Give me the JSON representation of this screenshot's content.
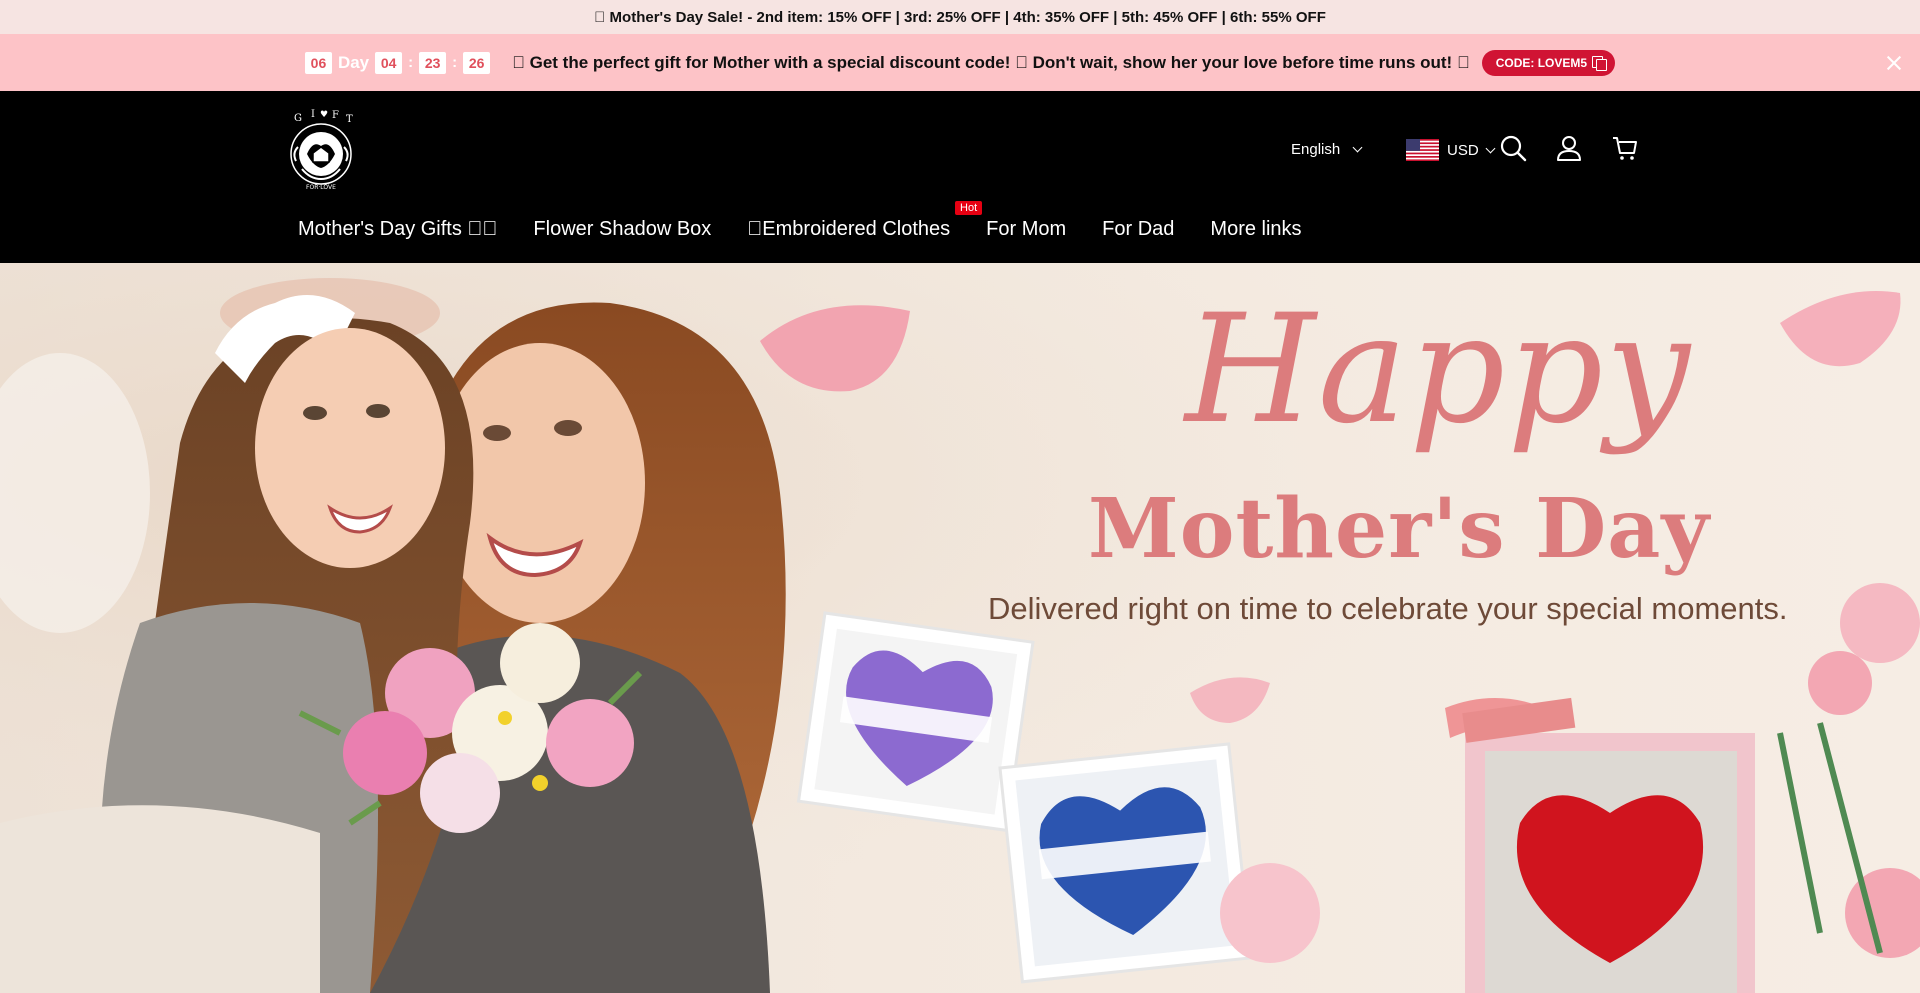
{
  "announcement": {
    "text": "\u0000 Mother's Day Sale! - 2nd item: 15% OFF | 3rd: 25% OFF | 4th: 35% OFF | 5th: 45% OFF | 6th: 55% OFF"
  },
  "promo": {
    "countdown": {
      "days": "06",
      "day_label": "Day",
      "hours": "04",
      "minutes": "23",
      "seconds": "26",
      "sep": ":"
    },
    "message": "\u0000 Get the perfect gift for Mother with a special discount code! \u0000 Don't wait, show her your love before time runs out! \u0000",
    "code_label": "CODE: LOVEM5"
  },
  "header": {
    "language": "English",
    "currency": "USD",
    "nav": [
      {
        "label": "Mother's Day Gifts \u0000\u0000"
      },
      {
        "label": "Flower Shadow Box"
      },
      {
        "label": "\u0000Embroidered Clothes",
        "badge": "Hot"
      },
      {
        "label": "For Mom"
      },
      {
        "label": "For Dad"
      },
      {
        "label": "More links"
      }
    ]
  },
  "hero": {
    "title_script": "Happy",
    "title_main": "Mother's Day",
    "subtitle": "Delivered right on time to celebrate your special moments."
  },
  "colors": {
    "promo_bg": "#fdc3c7",
    "code_btn": "#d01434",
    "hero_title": "#dc7c7d",
    "header_bg": "#000000"
  },
  "icons": [
    "logo",
    "copy-icon",
    "close-icon",
    "chevron-down-icon",
    "us-flag-icon",
    "search-icon",
    "account-icon",
    "cart-icon"
  ]
}
